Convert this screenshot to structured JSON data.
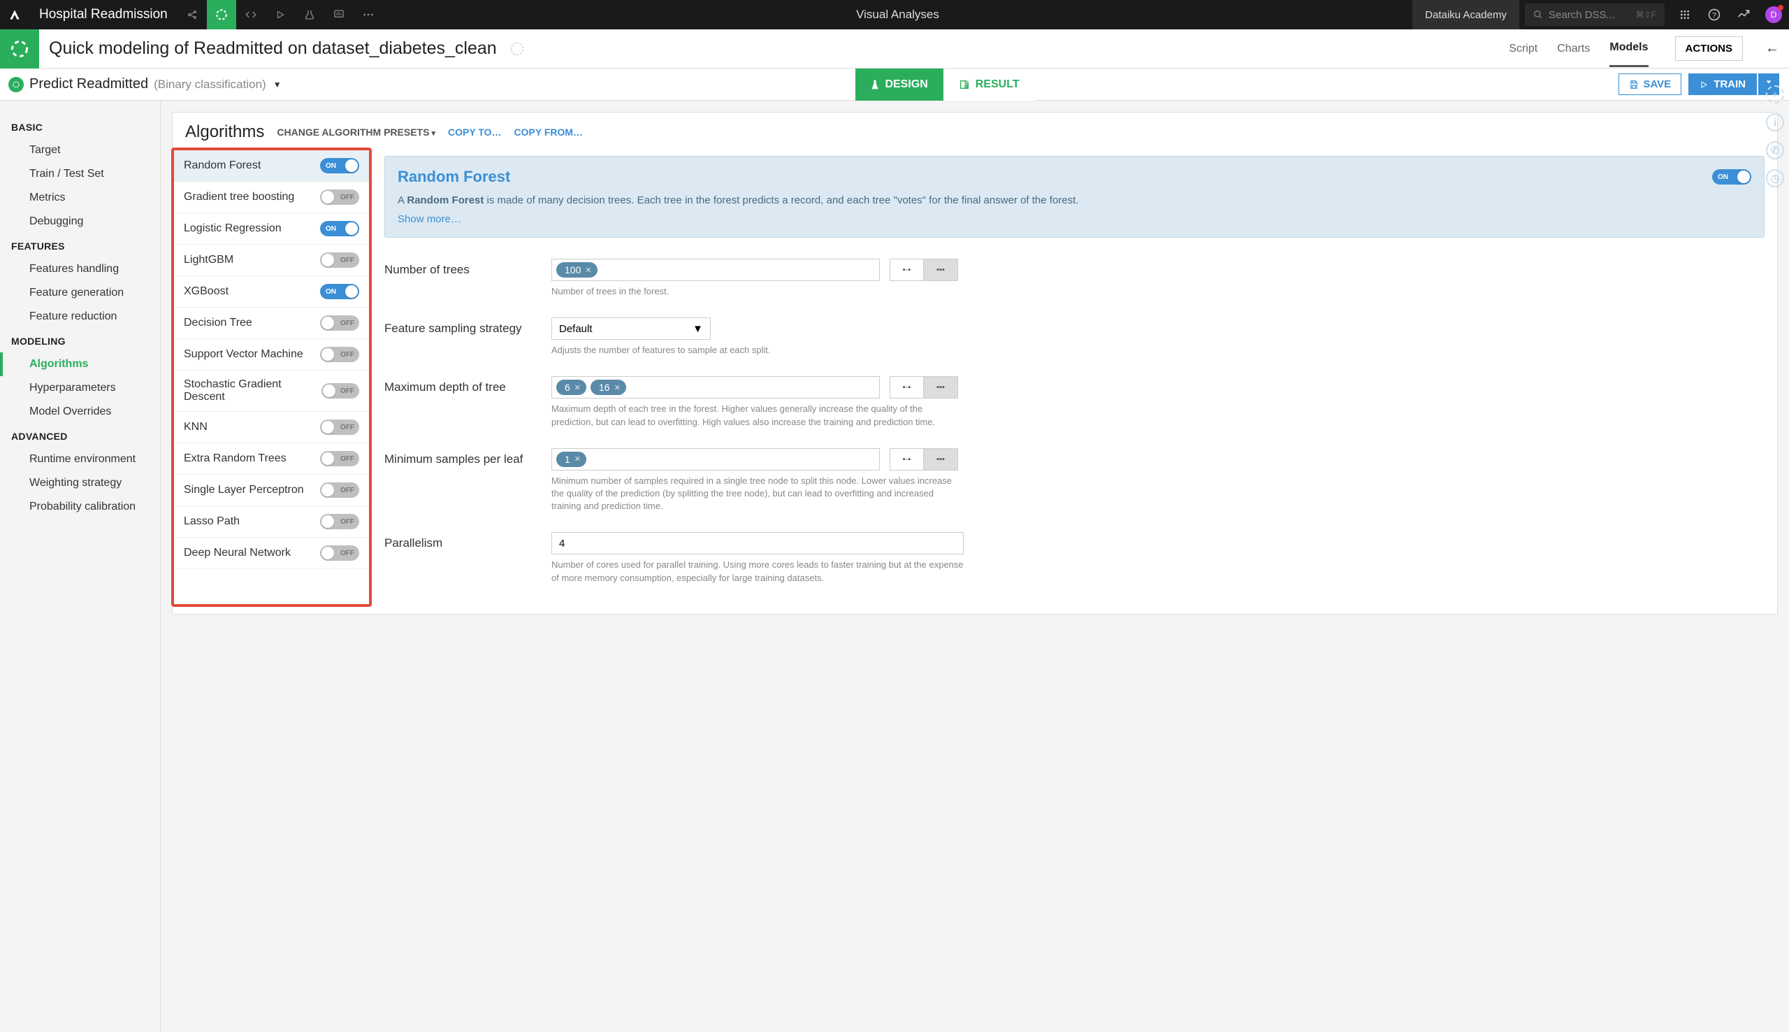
{
  "topbar": {
    "project_title": "Hospital Readmission",
    "center_tab": "Visual Analyses",
    "academy": "Dataiku Academy",
    "search_placeholder": "Search DSS...",
    "search_kbd": "⌘⇧F",
    "avatar_letter": "D"
  },
  "subheader": {
    "title": "Quick modeling of Readmitted on dataset_diabetes_clean",
    "tabs": {
      "script": "Script",
      "charts": "Charts",
      "models": "Models"
    },
    "actions": "ACTIONS"
  },
  "modelrow": {
    "title": "Predict Readmitted",
    "subtitle": "(Binary classification)",
    "design": "DESIGN",
    "result": "RESULT",
    "save": "SAVE",
    "train": "TRAIN"
  },
  "sidebar": {
    "groups": [
      {
        "title": "BASIC",
        "items": [
          "Target",
          "Train / Test Set",
          "Metrics",
          "Debugging"
        ]
      },
      {
        "title": "FEATURES",
        "items": [
          "Features handling",
          "Feature generation",
          "Feature reduction"
        ]
      },
      {
        "title": "MODELING",
        "items": [
          "Algorithms",
          "Hyperparameters",
          "Model Overrides"
        ]
      },
      {
        "title": "ADVANCED",
        "items": [
          "Runtime environment",
          "Weighting strategy",
          "Probability calibration"
        ]
      }
    ],
    "active": "Algorithms"
  },
  "algo_header": {
    "title": "Algorithms",
    "change_presets": "CHANGE ALGORITHM PRESETS",
    "copy_to": "COPY TO…",
    "copy_from": "COPY FROM…"
  },
  "algorithms": [
    {
      "name": "Random Forest",
      "on": true,
      "selected": true
    },
    {
      "name": "Gradient tree boosting",
      "on": false
    },
    {
      "name": "Logistic Regression",
      "on": true
    },
    {
      "name": "LightGBM",
      "on": false
    },
    {
      "name": "XGBoost",
      "on": true
    },
    {
      "name": "Decision Tree",
      "on": false
    },
    {
      "name": "Support Vector Machine",
      "on": false
    },
    {
      "name": "Stochastic Gradient Descent",
      "on": false
    },
    {
      "name": "KNN",
      "on": false
    },
    {
      "name": "Extra Random Trees",
      "on": false
    },
    {
      "name": "Single Layer Perceptron",
      "on": false
    },
    {
      "name": "Lasso Path",
      "on": false
    },
    {
      "name": "Deep Neural Network",
      "on": false
    }
  ],
  "detail": {
    "title": "Random Forest",
    "desc_prefix": "A ",
    "desc_bold": "Random Forest",
    "desc_rest": " is made of many decision trees. Each tree in the forest predicts a record, and each tree \"votes\" for the final answer of the forest.",
    "show_more": "Show more…",
    "toggle_on": "ON"
  },
  "params": {
    "num_trees": {
      "label": "Number of trees",
      "chips": [
        "100"
      ],
      "help": "Number of trees in the forest."
    },
    "feat_sampling": {
      "label": "Feature sampling strategy",
      "value": "Default",
      "help": "Adjusts the number of features to sample at each split."
    },
    "max_depth": {
      "label": "Maximum depth of tree",
      "chips": [
        "6",
        "16"
      ],
      "help": "Maximum depth of each tree in the forest. Higher values generally increase the quality of the prediction, but can lead to overfitting. High values also increase the training and prediction time."
    },
    "min_samples": {
      "label": "Minimum samples per leaf",
      "chips": [
        "1"
      ],
      "help": "Minimum number of samples required in a single tree node to split this node. Lower values increase the quality of the prediction (by splitting the tree node), but can lead to overfitting and increased training and prediction time."
    },
    "parallelism": {
      "label": "Parallelism",
      "value": "4",
      "help": "Number of cores used for parallel training. Using more cores leads to faster training but at the expense of more memory consumption, especially for large training datasets."
    }
  },
  "toggle_labels": {
    "on": "ON",
    "off": "OFF"
  }
}
